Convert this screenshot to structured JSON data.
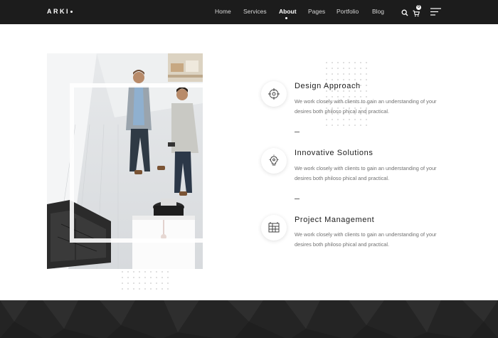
{
  "brand": {
    "logo": "ARKI"
  },
  "nav": {
    "items": [
      {
        "label": "Home",
        "active": false
      },
      {
        "label": "Services",
        "active": false
      },
      {
        "label": "About",
        "active": true
      },
      {
        "label": "Pages",
        "active": false
      },
      {
        "label": "Portfolio",
        "active": false
      },
      {
        "label": "Blog",
        "active": false
      }
    ],
    "icons": [
      "search-icon",
      "cart-icon",
      "hamburger-menu-icon"
    ],
    "cart_count": "0"
  },
  "features": [
    {
      "icon": "design-approach-icon",
      "title": "Design Approach",
      "text": "We work closely with clients to gain an understanding of your desires both philoso phical and practical."
    },
    {
      "icon": "innovative-solutions-icon",
      "title": "Innovative Solutions",
      "text": "We work closely with clients to gain an understanding of your desires both philoso phical and practical."
    },
    {
      "icon": "project-management-icon",
      "title": "Project Management",
      "text": "We work closely with clients to gain an understanding of your desires both philoso phical and practical."
    }
  ],
  "colors": {
    "nav_bg": "#1c1c1c",
    "footer_bg": "#242424",
    "text_muted": "#707070"
  }
}
